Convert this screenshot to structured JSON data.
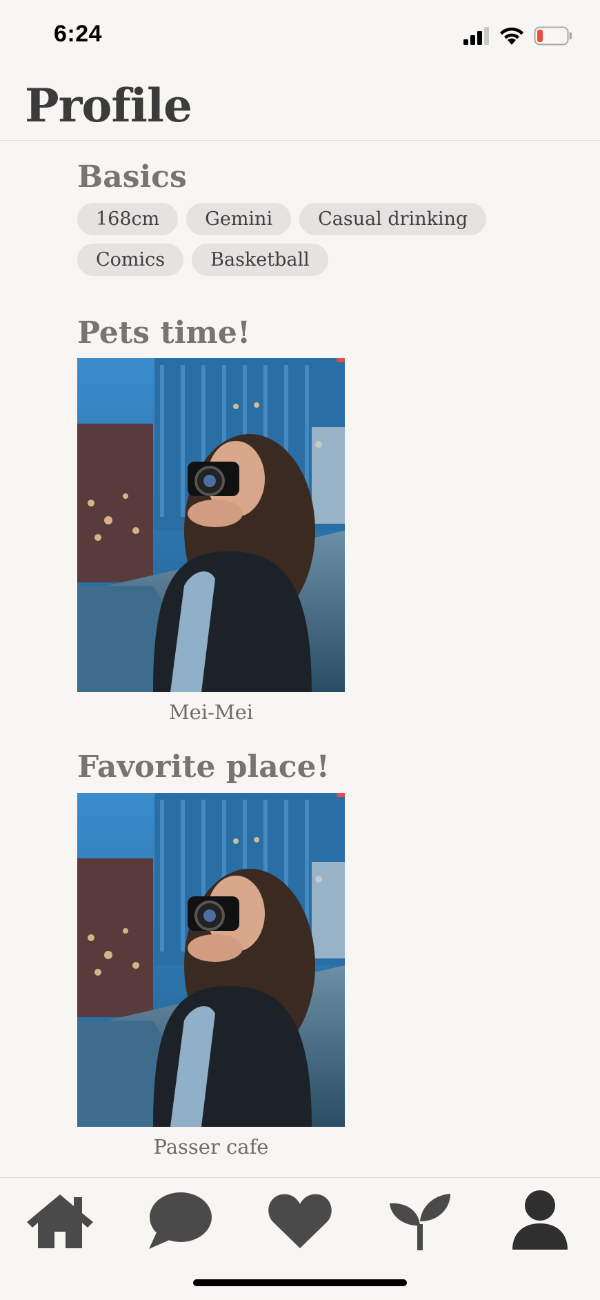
{
  "status_bar": {
    "time": "6:24",
    "icons": [
      "cellular-signal-icon",
      "wifi-icon",
      "battery-low-icon"
    ],
    "battery_color": "#e74c3c"
  },
  "header": {
    "title": "Profile"
  },
  "basics": {
    "title": "Basics",
    "tags_row1": [
      "168cm",
      "Gemini",
      "Casual drinking"
    ],
    "tags_row2": [
      "Comics",
      "Basketball"
    ]
  },
  "pets": {
    "title": "Pets time!",
    "caption": "Mei-Mei"
  },
  "favorite_place": {
    "title": "Favorite place!",
    "caption": "Passer cafe"
  },
  "tab_bar": {
    "tabs": [
      "home-icon",
      "chat-bubble-icon",
      "heart-icon",
      "sprout-icon",
      "profile-icon"
    ],
    "icon_color": "#4a4a4a"
  }
}
